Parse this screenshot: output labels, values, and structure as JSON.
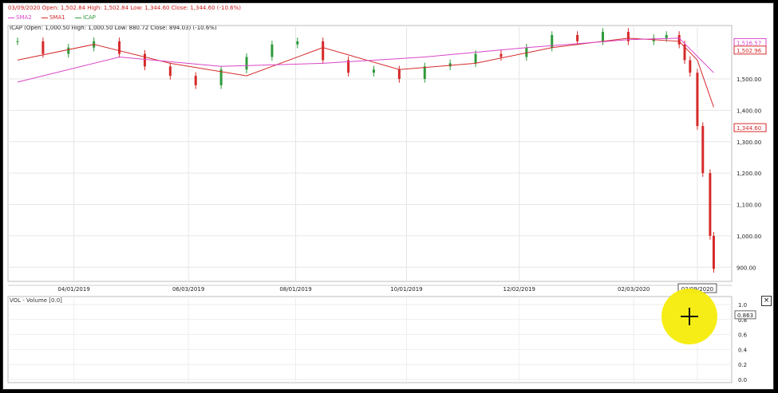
{
  "header": {
    "info_line": "03/09/2020 Open: 1,502.84 High: 1,502.84 Low: 1,344.60 Close: 1,344.60 (-10.6%)",
    "legend": [
      {
        "label": "SMA2",
        "color": "#d946c8"
      },
      {
        "label": "SMA1",
        "color": "#d62a2a"
      },
      {
        "label": "ICAP",
        "color": "#2e9a3a"
      }
    ],
    "sub_info": "ICAP (Open: 1,000.50 High: 1,000.50 Low: 880.72 Close: 894.03) (-10.6%)"
  },
  "price_labels": {
    "sma2_value": "1,516.57",
    "sma1_value": "1,502.96",
    "close_value": "1,344.60"
  },
  "volume_panel": {
    "title": "VOL - Volume [0.0]",
    "y_ticks": [
      "1.0",
      "0.8",
      "0.6",
      "0.4",
      "0.2",
      "0.0"
    ],
    "marker": "0.863",
    "close_label": "×"
  },
  "chart_data": {
    "type": "candlestick",
    "x_ticks": [
      "04/01/2019",
      "06/03/2019",
      "08/01/2019",
      "10/01/2019",
      "12/02/2019",
      "02/03/2020",
      "03/09/2020"
    ],
    "y_ticks": [
      900,
      1000,
      1100,
      1200,
      1300,
      1400,
      1500
    ],
    "ylim": [
      855,
      1650
    ],
    "x_range": [
      "2019-03-01",
      "2020-03-20"
    ],
    "series": [
      {
        "name": "ICAP",
        "color": "#2e9a3a",
        "down_color": "#d62a2a",
        "x": [
          "2019-03-01",
          "2019-03-15",
          "2019-03-29",
          "2019-04-12",
          "2019-04-26",
          "2019-05-10",
          "2019-05-24",
          "2019-06-07",
          "2019-06-21",
          "2019-07-05",
          "2019-07-19",
          "2019-08-02",
          "2019-08-16",
          "2019-08-30",
          "2019-09-13",
          "2019-09-27",
          "2019-10-11",
          "2019-10-25",
          "2019-11-08",
          "2019-11-22",
          "2019-12-06",
          "2019-12-20",
          "2020-01-03",
          "2020-01-17",
          "2020-01-31",
          "2020-02-14",
          "2020-02-21",
          "2020-02-28",
          "2020-03-02",
          "2020-03-05",
          "2020-03-09",
          "2020-03-12",
          "2020-03-16",
          "2020-03-18"
        ],
        "close": [
          1620,
          1580,
          1600,
          1620,
          1580,
          1540,
          1510,
          1480,
          1530,
          1570,
          1610,
          1620,
          1560,
          1520,
          1530,
          1500,
          1540,
          1550,
          1580,
          1570,
          1600,
          1640,
          1620,
          1650,
          1620,
          1630,
          1640,
          1610,
          1560,
          1520,
          1350,
          1200,
          1000,
          895
        ]
      },
      {
        "name": "SMA1",
        "color": "#d62a2a",
        "x": [
          "2019-03-01",
          "2019-04-12",
          "2019-05-24",
          "2019-07-05",
          "2019-08-16",
          "2019-09-27",
          "2019-11-08",
          "2019-12-20",
          "2020-01-31",
          "2020-02-28",
          "2020-03-09",
          "2020-03-18"
        ],
        "y": [
          1560,
          1610,
          1550,
          1510,
          1600,
          1530,
          1550,
          1600,
          1630,
          1620,
          1560,
          1410
        ]
      },
      {
        "name": "SMA2",
        "color": "#d946c8",
        "x": [
          "2019-03-01",
          "2019-04-26",
          "2019-06-21",
          "2019-08-16",
          "2019-10-11",
          "2019-12-06",
          "2020-01-31",
          "2020-02-28",
          "2020-03-18"
        ],
        "y": [
          1490,
          1570,
          1540,
          1550,
          1570,
          1600,
          1625,
          1630,
          1520
        ]
      }
    ]
  }
}
